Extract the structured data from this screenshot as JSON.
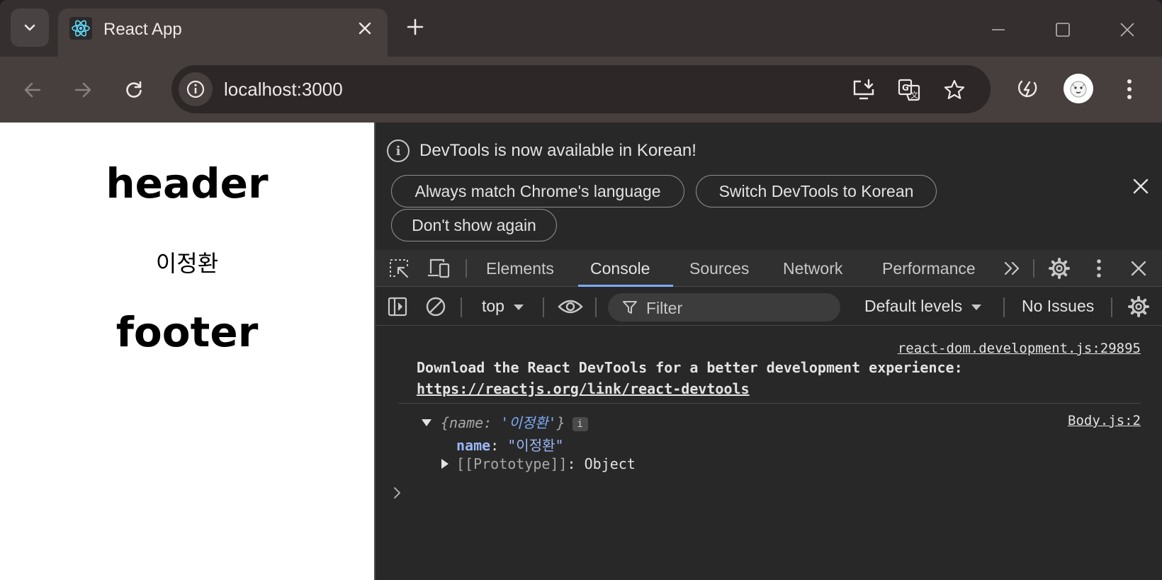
{
  "browser": {
    "tab_title": "React App",
    "url": "localhost:3000"
  },
  "page": {
    "header": "header",
    "name": "이정환",
    "footer": "footer"
  },
  "devtools": {
    "infobar": {
      "message": "DevTools is now available in Korean!",
      "btn_match": "Always match Chrome's language",
      "btn_switch": "Switch DevTools to Korean",
      "btn_dont_show": "Don't show again"
    },
    "tabs": [
      "Elements",
      "Console",
      "Sources",
      "Network",
      "Performance"
    ],
    "active_tab": "Console",
    "console_toolbar": {
      "context": "top",
      "filter_placeholder": "Filter",
      "levels": "Default levels",
      "issues": "No Issues"
    },
    "console": {
      "msg1_source": "react-dom.development.js:29895",
      "msg1_text": "Download the React DevTools for a better development experience:",
      "msg1_link": "https://reactjs.org/link/react-devtools",
      "msg2_source": "Body.js:2",
      "obj_preview_open": "{name: ",
      "obj_preview_value": "'이정환'",
      "obj_preview_close": "}",
      "obj_badge": "i",
      "prop_key": "name",
      "prop_value": "\"이정환\"",
      "proto_key": "[[Prototype]]",
      "proto_value": ": Object"
    }
  },
  "colors": {
    "accent": "#7cacf8",
    "chrome_frame": "#352f2f",
    "toolbar": "#473e3e",
    "devtools_bg": "#282828"
  }
}
